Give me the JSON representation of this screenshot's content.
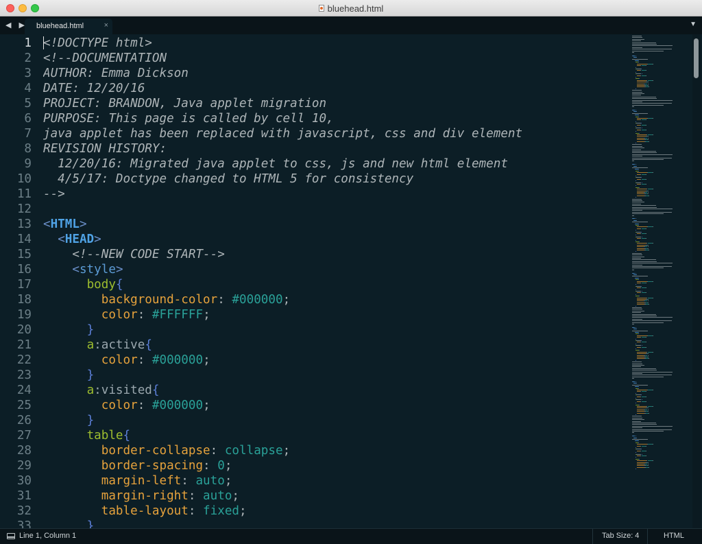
{
  "window": {
    "title": "bluehead.html"
  },
  "tabs": [
    {
      "label": "bluehead.html",
      "close": "×"
    }
  ],
  "nav": {
    "arrows": "◀ ▶",
    "dropdown": "▼"
  },
  "editor": {
    "active_line": 1,
    "line_numbers": [
      "1",
      "2",
      "3",
      "4",
      "5",
      "6",
      "7",
      "8",
      "9",
      "10",
      "11",
      "12",
      "13",
      "14",
      "15",
      "16",
      "17",
      "18",
      "19",
      "20",
      "21",
      "22",
      "23",
      "24",
      "25",
      "26",
      "27",
      "28",
      "29",
      "30",
      "31",
      "32",
      "33"
    ],
    "lines": [
      [
        {
          "t": "<!DOCTYPE html>",
          "c": "cm"
        }
      ],
      [
        {
          "t": "<!--DOCUMENTATION",
          "c": "cm"
        }
      ],
      [
        {
          "t": "AUTHOR: Emma Dickson",
          "c": "cm"
        }
      ],
      [
        {
          "t": "DATE: 12/20/16",
          "c": "cm"
        }
      ],
      [
        {
          "t": "PROJECT: BRANDON, Java applet migration",
          "c": "cm"
        }
      ],
      [
        {
          "t": "PURPOSE: This page is called by cell 10,",
          "c": "cm"
        }
      ],
      [
        {
          "t": "java applet has been replaced with javascript, css and div element",
          "c": "cm"
        }
      ],
      [
        {
          "t": "REVISION HISTORY:",
          "c": "cm"
        }
      ],
      [
        {
          "t": "  12/20/16: Migrated java applet to css, js and new html element",
          "c": "cm"
        }
      ],
      [
        {
          "t": "  4/5/17: Doctype changed to HTML 5 for consistency",
          "c": "cm"
        }
      ],
      [
        {
          "t": "-->",
          "c": "cm"
        }
      ],
      [],
      [
        {
          "t": "<",
          "c": "tg"
        },
        {
          "t": "HTML",
          "c": "tn"
        },
        {
          "t": ">",
          "c": "tg"
        }
      ],
      [
        {
          "t": "  ",
          "c": ""
        },
        {
          "t": "<",
          "c": "tg"
        },
        {
          "t": "HEAD",
          "c": "tn"
        },
        {
          "t": ">",
          "c": "tg"
        }
      ],
      [
        {
          "t": "    <!--NEW CODE START-->",
          "c": "cm"
        }
      ],
      [
        {
          "t": "    ",
          "c": ""
        },
        {
          "t": "<",
          "c": "tg"
        },
        {
          "t": "style",
          "c": "tn2"
        },
        {
          "t": ">",
          "c": "tg"
        }
      ],
      [
        {
          "t": "      ",
          "c": ""
        },
        {
          "t": "body",
          "c": "sel"
        },
        {
          "t": "{",
          "c": "br"
        }
      ],
      [
        {
          "t": "        ",
          "c": ""
        },
        {
          "t": "background-color",
          "c": "prop"
        },
        {
          "t": ": ",
          "c": "punc"
        },
        {
          "t": "#000000",
          "c": "val"
        },
        {
          "t": ";",
          "c": "punc"
        }
      ],
      [
        {
          "t": "        ",
          "c": ""
        },
        {
          "t": "color",
          "c": "prop"
        },
        {
          "t": ": ",
          "c": "punc"
        },
        {
          "t": "#FFFFFF",
          "c": "val"
        },
        {
          "t": ";",
          "c": "punc"
        }
      ],
      [
        {
          "t": "      ",
          "c": ""
        },
        {
          "t": "}",
          "c": "br"
        }
      ],
      [
        {
          "t": "      ",
          "c": ""
        },
        {
          "t": "a",
          "c": "sel"
        },
        {
          "t": ":active",
          "c": "ps"
        },
        {
          "t": "{",
          "c": "br"
        }
      ],
      [
        {
          "t": "        ",
          "c": ""
        },
        {
          "t": "color",
          "c": "prop"
        },
        {
          "t": ": ",
          "c": "punc"
        },
        {
          "t": "#000000",
          "c": "val"
        },
        {
          "t": ";",
          "c": "punc"
        }
      ],
      [
        {
          "t": "      ",
          "c": ""
        },
        {
          "t": "}",
          "c": "br"
        }
      ],
      [
        {
          "t": "      ",
          "c": ""
        },
        {
          "t": "a",
          "c": "sel"
        },
        {
          "t": ":visited",
          "c": "ps"
        },
        {
          "t": "{",
          "c": "br"
        }
      ],
      [
        {
          "t": "        ",
          "c": ""
        },
        {
          "t": "color",
          "c": "prop"
        },
        {
          "t": ": ",
          "c": "punc"
        },
        {
          "t": "#000000",
          "c": "val"
        },
        {
          "t": ";",
          "c": "punc"
        }
      ],
      [
        {
          "t": "      ",
          "c": ""
        },
        {
          "t": "}",
          "c": "br"
        }
      ],
      [
        {
          "t": "      ",
          "c": ""
        },
        {
          "t": "table",
          "c": "sel"
        },
        {
          "t": "{",
          "c": "br"
        }
      ],
      [
        {
          "t": "        ",
          "c": ""
        },
        {
          "t": "border-collapse",
          "c": "prop"
        },
        {
          "t": ": ",
          "c": "punc"
        },
        {
          "t": "collapse",
          "c": "val"
        },
        {
          "t": ";",
          "c": "punc"
        }
      ],
      [
        {
          "t": "        ",
          "c": ""
        },
        {
          "t": "border-spacing",
          "c": "prop"
        },
        {
          "t": ": ",
          "c": "punc"
        },
        {
          "t": "0",
          "c": "val"
        },
        {
          "t": ";",
          "c": "punc"
        }
      ],
      [
        {
          "t": "        ",
          "c": ""
        },
        {
          "t": "margin-left",
          "c": "prop"
        },
        {
          "t": ": ",
          "c": "punc"
        },
        {
          "t": "auto",
          "c": "val"
        },
        {
          "t": ";",
          "c": "punc"
        }
      ],
      [
        {
          "t": "        ",
          "c": ""
        },
        {
          "t": "margin-right",
          "c": "prop"
        },
        {
          "t": ": ",
          "c": "punc"
        },
        {
          "t": "auto",
          "c": "val"
        },
        {
          "t": ";",
          "c": "punc"
        }
      ],
      [
        {
          "t": "        ",
          "c": ""
        },
        {
          "t": "table-layout",
          "c": "prop"
        },
        {
          "t": ": ",
          "c": "punc"
        },
        {
          "t": "fixed",
          "c": "val"
        },
        {
          "t": ";",
          "c": "punc"
        }
      ],
      [
        {
          "t": "      ",
          "c": ""
        },
        {
          "t": "}",
          "c": "br"
        }
      ]
    ]
  },
  "status": {
    "position": "Line 1, Column 1",
    "tab_size": "Tab Size: 4",
    "syntax": "HTML"
  },
  "colors": {
    "background": "#0c1e26",
    "comment": "#aeb5b8",
    "tag": "#4fa3e6",
    "selector": "#9dbd2f",
    "property": "#e6a23c",
    "value": "#2aa198",
    "brace": "#5c7fd8"
  }
}
